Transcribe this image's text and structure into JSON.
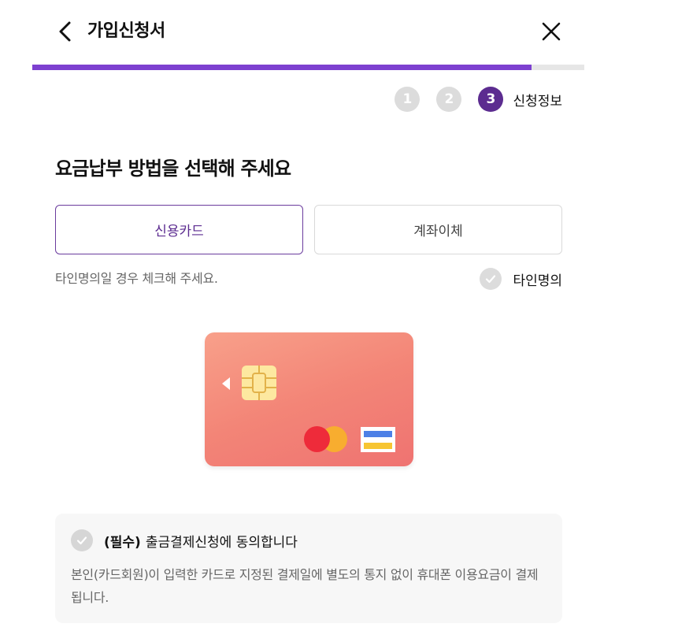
{
  "header": {
    "title": "가입신청서"
  },
  "progress": {
    "fraction": 0.905
  },
  "steps": {
    "items": [
      "1",
      "2",
      "3"
    ],
    "active_index": 2,
    "active_label": "신청정보"
  },
  "section": {
    "title": "요금납부 방법을 선택해 주세요"
  },
  "payment_methods": {
    "options": [
      "신용카드",
      "계좌이체"
    ],
    "selected": "신용카드"
  },
  "other_name": {
    "note": "타인명의일 경우 체크해 주세요.",
    "checkbox_label": "타인명의"
  },
  "agreement": {
    "required_label": "(필수)",
    "label": "출금결제신청에 동의합니다",
    "description": "본인(카드회원)이 입력한 카드로 지정된 결제일에 별도의 통지 없이 휴대폰 이용요금이 결제됩니다."
  },
  "colors": {
    "accent": "#7d40d0",
    "step_active": "#5c2c90",
    "card_gradient": [
      "#f8a08a",
      "#ef7371"
    ]
  },
  "icons": [
    "chevron-left-icon",
    "close-icon",
    "check-icon",
    "card-chip-icon",
    "card-brand-icon"
  ]
}
